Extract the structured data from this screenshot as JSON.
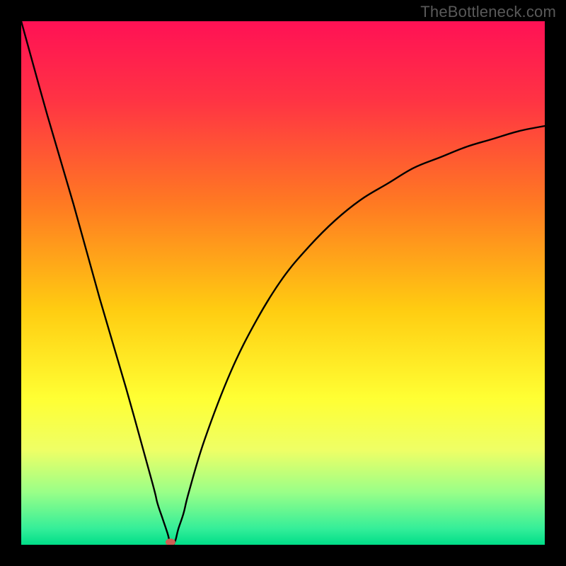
{
  "watermark": "TheBottleneck.com",
  "chart_data": {
    "type": "line",
    "title": "",
    "xlabel": "",
    "ylabel": "",
    "xlim": [
      0,
      100
    ],
    "ylim": [
      0,
      100
    ],
    "x": [
      0,
      5,
      10,
      15,
      20,
      25,
      26,
      27,
      28,
      28.5,
      29,
      29.5,
      30,
      31,
      32,
      35,
      40,
      45,
      50,
      55,
      60,
      65,
      70,
      75,
      80,
      85,
      90,
      95,
      100
    ],
    "values": [
      100,
      82,
      65,
      47,
      30,
      12,
      8,
      5,
      2,
      0,
      0,
      1,
      3,
      6,
      10,
      20,
      33,
      43,
      51,
      57,
      62,
      66,
      69,
      72,
      74,
      76,
      77.5,
      79,
      80
    ],
    "annotations": [
      {
        "type": "marker",
        "x": 28.5,
        "y": 0.5,
        "shape": "ellipse",
        "color": "#cc5f54"
      }
    ],
    "background": "rainbow-vertical-gradient",
    "grid": false,
    "legend": false
  },
  "colors": {
    "gradient_stops": [
      {
        "offset": 0,
        "color": "#ff1155"
      },
      {
        "offset": 0.15,
        "color": "#ff3344"
      },
      {
        "offset": 0.35,
        "color": "#ff7a22"
      },
      {
        "offset": 0.55,
        "color": "#ffcc11"
      },
      {
        "offset": 0.72,
        "color": "#ffff33"
      },
      {
        "offset": 0.82,
        "color": "#eeff66"
      },
      {
        "offset": 0.9,
        "color": "#99ff88"
      },
      {
        "offset": 0.97,
        "color": "#33ee99"
      },
      {
        "offset": 1.0,
        "color": "#00dd88"
      }
    ],
    "curve": "#000000",
    "marker": "#cc5f54",
    "frame": "#000000"
  }
}
